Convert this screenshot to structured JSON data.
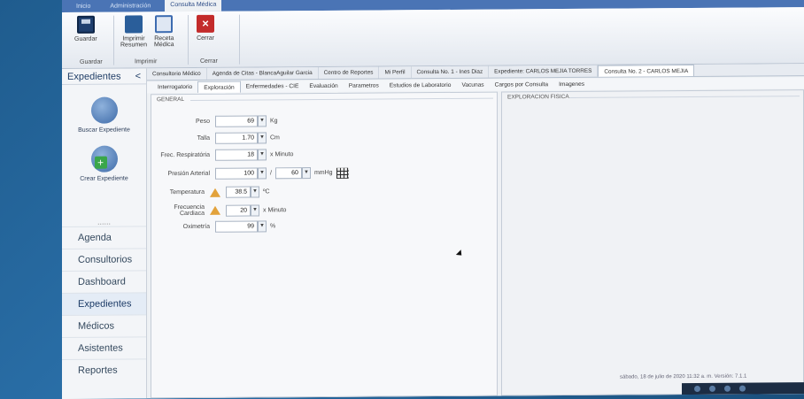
{
  "ribbon_tabs": [
    "Inicio",
    "Administración",
    "Consulta Médica"
  ],
  "ribbon": {
    "save": "Guardar",
    "print_l1": "Imprimir",
    "print_l2": "Resumen",
    "rx_l1": "Receta",
    "rx_l2": "Médica",
    "close": "Cerrar",
    "group_guardar": "Guardar",
    "group_imprimir": "Imprimir",
    "group_cerrar": "Cerrar"
  },
  "sidebar": {
    "title": "Expedientes",
    "collapse": "<",
    "buscar": "Buscar Expediente",
    "crear": "Crear Expediente",
    "dots": "......",
    "nav": [
      "Agenda",
      "Consultorios",
      "Dashboard",
      "Expedientes",
      "Médicos",
      "Asistentes",
      "Reportes"
    ]
  },
  "doc_tabs": [
    "Consultorio Médico",
    "Agenda de Citas - BlancaAguilar Garcia",
    "Centro de Reportes",
    "Mi Perfil",
    "Consulta No. 1 - Ines Diaz",
    "Expediente: CARLOS MEJIA TORRES",
    "Consulta No. 2 - CARLOS MEJIA"
  ],
  "sub_tabs": [
    "Interrogatorio",
    "Exploración",
    "Enfermedades - CIE",
    "Evaluación",
    "Parametros",
    "Estudios de Laboratorio",
    "Vacunas",
    "Cargos por Consulta",
    "Imagenes"
  ],
  "general": {
    "title": "GENERAL",
    "peso_label": "Peso",
    "peso_value": "69",
    "peso_unit": "Kg",
    "talla_label": "Talla",
    "talla_value": "1.70",
    "talla_unit": "Cm",
    "resp_label": "Frec. Respiratória",
    "resp_value": "18",
    "resp_unit": "x Minuto",
    "presion_label": "Presión Arterial",
    "presion_sys": "100",
    "presion_sep": "/",
    "presion_dia": "60",
    "presion_unit": "mmHg",
    "temp_label": "Temperatura",
    "temp_value": "38.5",
    "temp_unit": "ºC",
    "fc_label": "Frecuencia Cardiaca",
    "fc_value": "20",
    "fc_unit": "x Minuto",
    "oxi_label": "Oximetría",
    "oxi_value": "99",
    "oxi_unit": "%"
  },
  "exploracion": {
    "title": "EXPLORACION FISICA"
  },
  "status": "sábado, 18 de julio de 2020   11:32 a. m.   Versión: 7.1.1",
  "spin": "▼"
}
